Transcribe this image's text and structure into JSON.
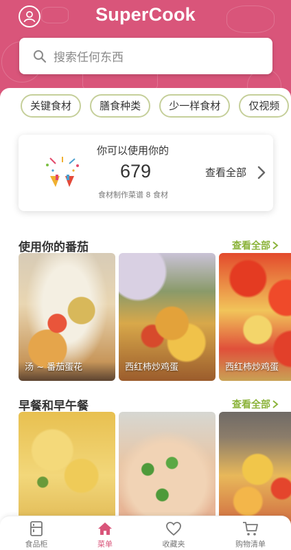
{
  "header": {
    "brand": "SuperCook",
    "brand_color": "#d9557a",
    "search_placeholder": "搜索任何东西"
  },
  "chips": [
    "关键食材",
    "膳食种类",
    "少一样食材",
    "仅视频"
  ],
  "summary_card": {
    "title": "你可以使用你的",
    "count": "679",
    "subtitle": "食材制作菜谱 8 食材",
    "see_all": "查看全部"
  },
  "sections": [
    {
      "title": "使用你的番茄",
      "link": "查看全部",
      "recipes": [
        {
          "caption": "汤 ~ 番茄蛋花"
        },
        {
          "caption": "西红柿炒鸡蛋"
        },
        {
          "caption": "西红柿炒鸡蛋"
        }
      ]
    },
    {
      "title": "早餐和早午餐",
      "link": "查看全部",
      "recipes": [
        {
          "caption": ""
        },
        {
          "caption": ""
        },
        {
          "caption": ""
        }
      ]
    }
  ],
  "tabbar": {
    "active": "菜单",
    "items": [
      {
        "label": "食品柜",
        "icon": "pantry-icon"
      },
      {
        "label": "菜单",
        "icon": "home-icon"
      },
      {
        "label": "收藏夹",
        "icon": "heart-icon"
      },
      {
        "label": "购物清单",
        "icon": "cart-icon"
      }
    ]
  },
  "colors": {
    "accent": "#d9557a",
    "link_green": "#8bb33a",
    "chip_border": "#c5cf9a"
  }
}
